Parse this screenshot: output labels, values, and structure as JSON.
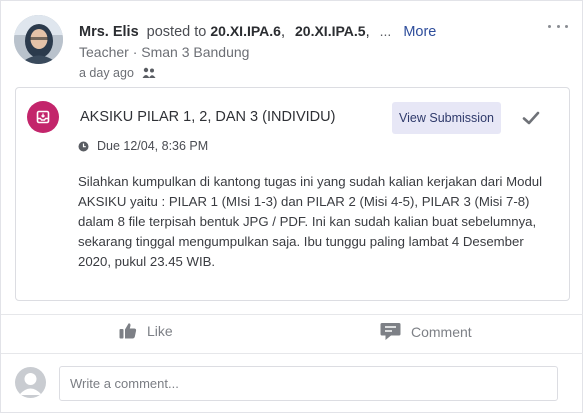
{
  "post": {
    "author": "Mrs. Elis",
    "posted_to_text": "posted to",
    "groups": [
      "20.XI.IPA.6",
      "20.XI.IPA.5",
      "..."
    ],
    "more_label": "More",
    "role": "Teacher · Sman 3 Bandung",
    "time": "a day ago",
    "menu_icon": "more-options-icon"
  },
  "assignment": {
    "title": "AKSIKU PILAR 1, 2, DAN 3 (INDIVIDU)",
    "view_button": "View Submission",
    "due": "Due 12/04, 8:36 PM",
    "body": "Silahkan kumpulkan di kantong tugas ini yang sudah kalian kerjakan dari Modul AKSIKU yaitu : PILAR 1 (MIsi 1-3) dan PILAR 2 (Misi 4-5), PILAR 3 (Misi 7-8) dalam 8 file terpisah bentuk JPG / PDF. Ini kan sudah kalian buat sebelumnya, sekarang tinggal mengumpulkan saja. Ibu tunggu paling lambat 4 Desember 2020, pukul 23.45 WIB.",
    "icon_color": "#c3256b"
  },
  "actions": {
    "like": "Like",
    "comment": "Comment"
  },
  "comment_box": {
    "placeholder": "Write a comment..."
  }
}
